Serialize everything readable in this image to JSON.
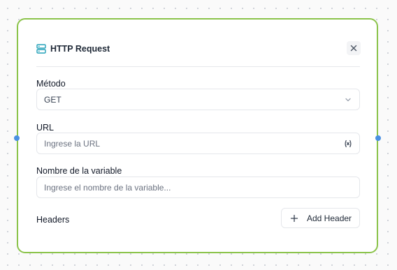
{
  "node": {
    "title": "HTTP Request",
    "icon": "server-icon",
    "accent_color": "#8bc34a",
    "handle_color": "#4a90e2",
    "close_icon": "close-icon"
  },
  "fields": {
    "method": {
      "label": "Método",
      "value": "GET",
      "icon": "chevron-down-icon"
    },
    "url": {
      "label": "URL",
      "placeholder": "Ingrese la URL",
      "icon": "variable-icon"
    },
    "variable_name": {
      "label": "Nombre de la variable",
      "placeholder": "Ingrese el nombre de la variable..."
    }
  },
  "headers": {
    "label": "Headers",
    "add_button_label": "Add Header",
    "add_icon": "plus-icon"
  }
}
